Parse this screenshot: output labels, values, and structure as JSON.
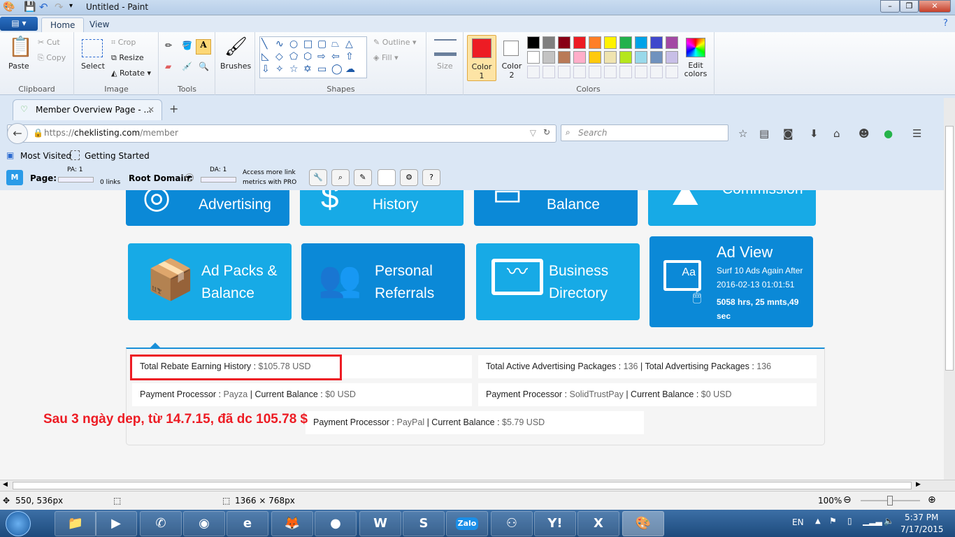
{
  "window": {
    "title": "Untitled - Paint"
  },
  "ribbon": {
    "tabs": [
      "Home",
      "View"
    ],
    "clipboard": {
      "paste": "Paste",
      "cut": "Cut",
      "copy": "Copy",
      "label": "Clipboard"
    },
    "image": {
      "select": "Select",
      "crop": "Crop",
      "resize": "Resize",
      "rotate": "Rotate",
      "label": "Image"
    },
    "tools": {
      "label": "Tools",
      "text_tool": "A"
    },
    "brushes": "Brushes",
    "shapes": {
      "label": "Shapes",
      "outline": "Outline",
      "fill": "Fill",
      "glyphs": [
        "╲",
        "∿",
        "○",
        "□",
        "▢",
        "⏢",
        "△",
        "◺",
        "◇",
        "⬠",
        "⬡",
        "⇨",
        "⇦",
        "⇧",
        "⇩",
        "✧",
        "☆",
        "✡",
        "▭",
        "◯",
        "☁"
      ]
    },
    "size": "Size",
    "color1": "Color 1",
    "color2": "Color 2",
    "colors_label": "Colors",
    "edit_colors": "Edit colors",
    "color1_value": "#ed1c24",
    "color2_value": "#ffffff",
    "palette_row1": [
      "#000000",
      "#7f7f7f",
      "#880015",
      "#ed1c24",
      "#ff7f27",
      "#fff200",
      "#22b14c",
      "#00a2e8",
      "#3f48cc",
      "#a349a4"
    ],
    "palette_row2": [
      "#ffffff",
      "#c3c3c3",
      "#b97a57",
      "#ffaec9",
      "#ffc90e",
      "#efe4b0",
      "#b5e61d",
      "#99d9ea",
      "#7092be",
      "#c8bfe7"
    ]
  },
  "browser": {
    "tab_title": "Member Overview Page - ...",
    "url_prefix": "https://",
    "url_domain": "cheklisting.com",
    "url_path": "/member",
    "search_placeholder": "Search",
    "bookmarks": [
      "Most Visited",
      "Getting Started"
    ],
    "moz": {
      "page_label": "Page:",
      "pa": "PA: 1",
      "links": "0 links",
      "root_label": "Root Domain:",
      "da": "DA: 1",
      "pro_line1": "Access more link",
      "pro_line2": "metrics with PRO"
    }
  },
  "page": {
    "top_cards": [
      "Advertising",
      "History",
      "Balance",
      "Commission"
    ],
    "cards": [
      {
        "line1": "Ad Packs &",
        "line2": "Balance"
      },
      {
        "line1": "Personal",
        "line2": "Referrals"
      },
      {
        "line1": "Business",
        "line2": "Directory"
      }
    ],
    "ad_view": {
      "title": "Ad View",
      "line1": "Surf 10 Ads Again After",
      "line2": "2016-02-13 01:01:51",
      "line3": "5058 hrs, 25 mnts,49",
      "line4": "sec"
    },
    "info": {
      "rebate_label": "Total Rebate Earning History : ",
      "rebate_value": "$105.78 USD",
      "active_label": "Total Active Advertising Packages : ",
      "active_value": "136",
      "total_label": " | Total Advertising Packages : ",
      "total_value": "136",
      "pp_label": "Payment Processor : ",
      "cb_label": " | Current Balance : ",
      "payza": "Payza",
      "payza_bal": "$0 USD",
      "stp": "SolidTrustPay",
      "stp_bal": "$0 USD",
      "paypal": "PayPal",
      "paypal_bal": "$5.79 USD"
    },
    "annotation": "Sau 3 ngày dep, từ 14.7.15, đã dc 105.78 $"
  },
  "status": {
    "cursor": "550, 536px",
    "canvas_size": "1366 × 768px",
    "zoom": "100%"
  },
  "taskbar": {
    "lang": "EN",
    "time": "5:37 PM",
    "date": "7/17/2015",
    "apps": [
      "Explorer",
      "Media",
      "Viber",
      "Chrome",
      "IE",
      "Firefox",
      "GOM",
      "Word",
      "Skype",
      "Zalo",
      "Kaspersky",
      "Yahoo",
      "Excel",
      "Paint"
    ]
  }
}
